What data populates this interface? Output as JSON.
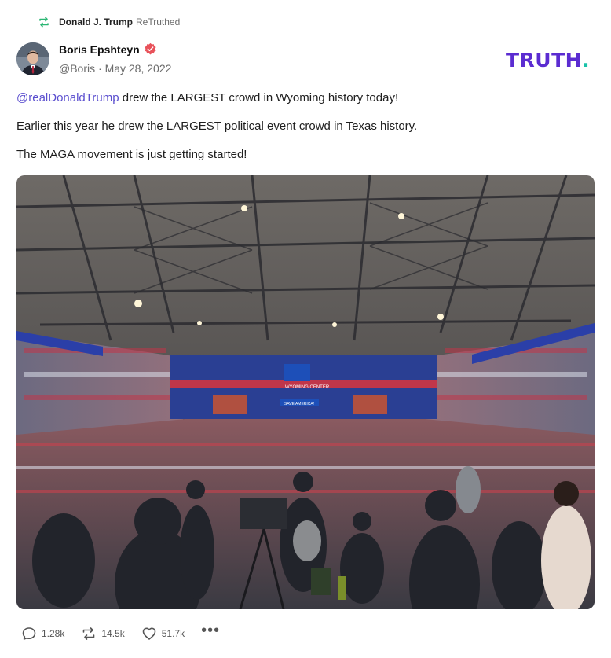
{
  "retruth": {
    "user": "Donald J. Trump",
    "verb": "ReTruthed"
  },
  "author": {
    "name": "Boris Epshteyn",
    "handle": "@Boris",
    "separator": "·",
    "date": "May 28, 2022"
  },
  "logo": {
    "text": "TRUTH",
    "dot": "."
  },
  "post": {
    "mention": "@realDonaldTrump",
    "line1_rest": " drew the LARGEST crowd in Wyoming history today!",
    "line2": "Earlier this year he drew the LARGEST political event crowd in Texas history.",
    "line3": "The MAGA movement is just getting started!"
  },
  "media_text": {
    "venue_sign": "WYOMING CENTER",
    "stage_banner": "SAVE AMERICA!"
  },
  "actions": {
    "replies": "1.28k",
    "retruths": "14.5k",
    "likes": "51.7k",
    "more": "•••"
  },
  "colors": {
    "brand": "#5b2cd1",
    "accent": "#19c2a9",
    "mention": "#5b4fcf",
    "verified": "#e8525a",
    "retruth_icon": "#2bb673"
  }
}
